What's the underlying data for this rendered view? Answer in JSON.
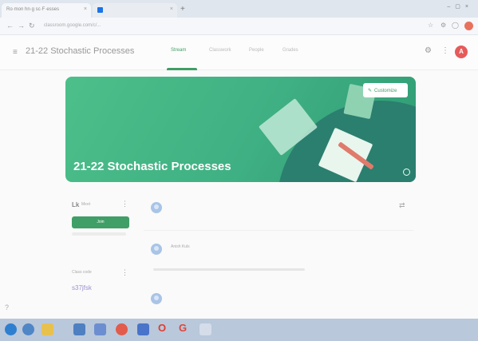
{
  "browser": {
    "tabs": [
      {
        "label": "Ro·mon hn·g sc·F·esses"
      },
      {
        "label": ""
      }
    ],
    "url": "classroom.google.com/c/..."
  },
  "header": {
    "title": "21-22 Stochastic Processes",
    "tabs": [
      {
        "label": "Stream"
      },
      {
        "label": "Classwork"
      },
      {
        "label": "People"
      },
      {
        "label": "Grades"
      }
    ],
    "avatar_initial": "A"
  },
  "banner": {
    "title": "21-22 Stochastic Processes",
    "customize_label": "Customize"
  },
  "meet": {
    "logo": "Lk",
    "label": "Meet",
    "join_label": "Join"
  },
  "class_code": {
    "label": "Class code",
    "value": "s37jfsk"
  },
  "stream": {
    "post_author": "Anish Kuls"
  },
  "colors": {
    "accent": "#3f9f66",
    "banner": "#3fb083",
    "avatar": "#e65a5a"
  },
  "icons": {
    "menu": "hamburger-icon",
    "settings": "gear-icon",
    "apps": "grid-icon",
    "customize": "pencil-icon",
    "repeat": "repeat-icon",
    "more": "kebab-icon"
  }
}
